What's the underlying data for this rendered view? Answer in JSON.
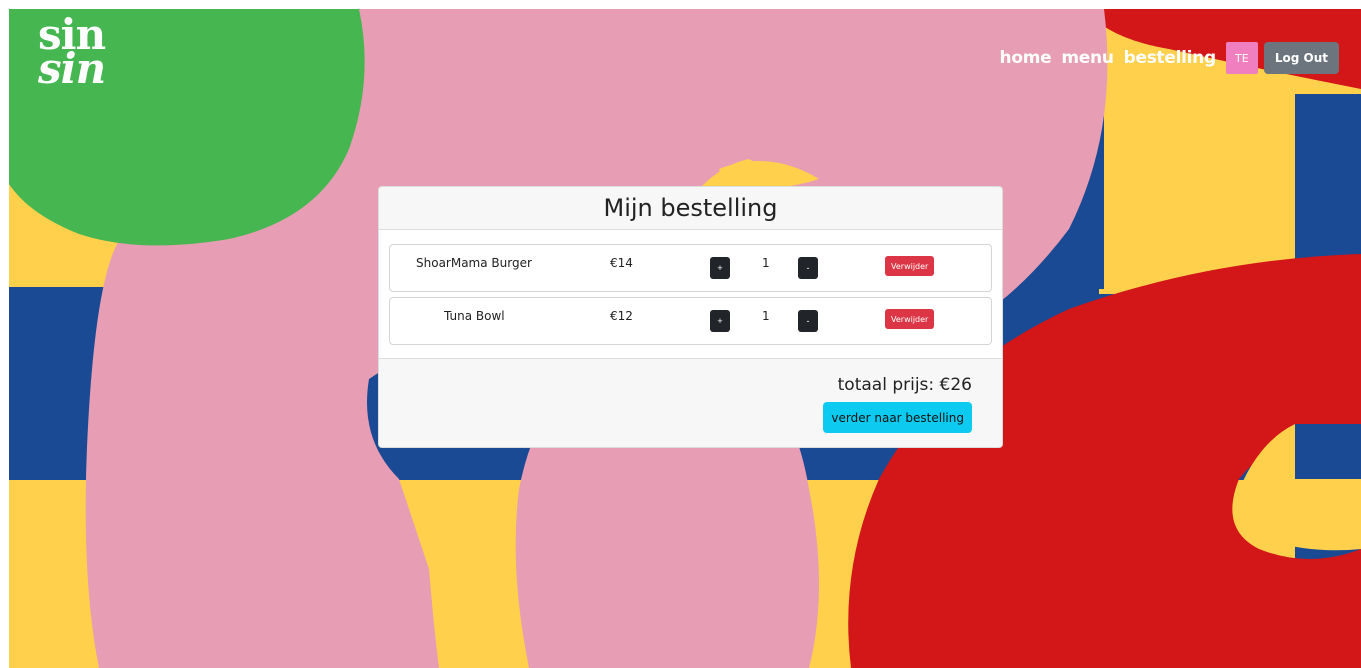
{
  "brand": {
    "line1": "sin",
    "line2": "sin"
  },
  "nav": {
    "links": [
      "home",
      "menu",
      "bestelling"
    ],
    "avatar_initials": "TE",
    "logout_label": "Log Out"
  },
  "order": {
    "title": "Mijn bestelling",
    "items": [
      {
        "name": "ShoarMama Burger",
        "price": "€14",
        "quantity": "1",
        "plus": "+",
        "minus": "-",
        "remove": "Verwijder"
      },
      {
        "name": "Tuna Bowl",
        "price": "€12",
        "quantity": "1",
        "plus": "+",
        "minus": "-",
        "remove": "Verwijder"
      }
    ],
    "total_label": "totaal prijs: €26",
    "proceed_label": "verder naar bestelling"
  },
  "colors": {
    "green": "#45b650",
    "pink": "#e79db3",
    "yellow": "#ffd04c",
    "blue": "#1b4a94",
    "red": "#d31617",
    "avatar": "#f07fbf",
    "logout": "#6c757d",
    "danger": "#dc3545",
    "info": "#0dcaf0"
  }
}
